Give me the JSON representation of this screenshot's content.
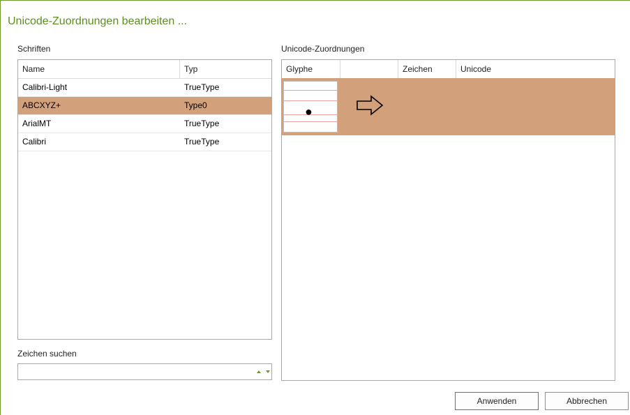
{
  "dialog": {
    "title": "Unicode-Zuordnungen bearbeiten ..."
  },
  "fonts": {
    "label": "Schriften",
    "columns": {
      "name": "Name",
      "type": "Typ"
    },
    "rows": [
      {
        "name": "Calibri-Light",
        "type": "TrueType",
        "selected": false
      },
      {
        "name": "ABCXYZ+",
        "type": "Type0",
        "selected": true
      },
      {
        "name": "ArialMT",
        "type": "TrueType",
        "selected": false
      },
      {
        "name": "Calibri",
        "type": "TrueType",
        "selected": false
      }
    ]
  },
  "search": {
    "label": "Zeichen suchen",
    "value": "",
    "placeholder": ""
  },
  "mappings": {
    "label": "Unicode-Zuordnungen",
    "columns": {
      "glyph": "Glyphe",
      "blank": "",
      "char": "Zeichen",
      "unicode": "Unicode"
    },
    "rows": [
      {
        "glyph": "●",
        "arrow_icon": "arrow-right-outline-icon",
        "char": "",
        "unicode": ""
      }
    ]
  },
  "buttons": {
    "apply": "Anwenden",
    "cancel": "Abbrechen"
  },
  "colors": {
    "title": "#5a8f1f",
    "selection": "#d3a07c",
    "spinner": "#6a9a2a"
  }
}
